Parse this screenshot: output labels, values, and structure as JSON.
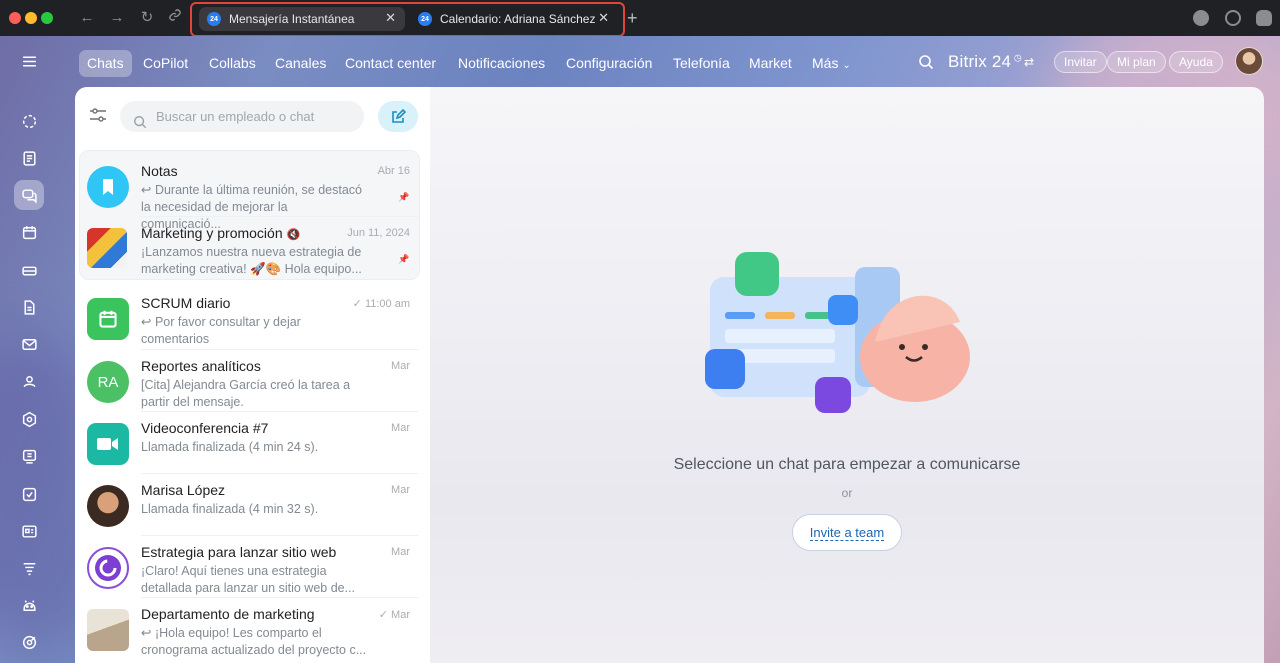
{
  "browser": {
    "tabs": [
      {
        "label": "Mensajería Instantánea",
        "favicon": "24",
        "active": true
      },
      {
        "label": "Calendario: Adriana Sánchez",
        "favicon": "24",
        "active": false
      }
    ]
  },
  "topnav": {
    "items": [
      "Chats",
      "CoPilot",
      "Collabs",
      "Canales",
      "Contact center",
      "Notificaciones",
      "Configuración",
      "Telefonía",
      "Market",
      "Más"
    ],
    "brand": "Bitrix 24",
    "invite": "Invitar",
    "plan": "Mi plan",
    "help": "Ayuda"
  },
  "sidebar_icons": [
    "activity-icon",
    "feed-icon",
    "chat-icon",
    "calendar-icon",
    "drive-icon",
    "document-icon",
    "mail-icon",
    "contacts-icon",
    "crm-icon",
    "boards-icon",
    "tasks-icon",
    "inventory-icon",
    "automation-icon",
    "android-icon",
    "sites-icon"
  ],
  "chatlist": {
    "search_placeholder": "Buscar un empleado o chat",
    "chats": [
      {
        "name": "Notas",
        "date": "Abr 16",
        "msg": "↩ Durante la última reunión, se destacó la necesidad de mejorar la comunicació...",
        "pinned": true
      },
      {
        "name": "Marketing y promoción",
        "date": "Jun 11, 2024",
        "msg": "¡Lanzamos nuestra nueva estrategia de marketing creativa! 🚀🎨 Hola equipo...",
        "pinned": true
      },
      {
        "name": "SCRUM diario",
        "date": "✓ 11:00 am",
        "msg": "↩ Por favor consultar y dejar comentarios"
      },
      {
        "name": "Reportes analíticos",
        "date": "Mar",
        "msg": "[Cita] Alejandra García creó la tarea a partir del mensaje.",
        "initials": "RA"
      },
      {
        "name": "Videoconferencia #7",
        "date": "Mar",
        "msg": "Llamada finalizada (4 min 24 s)."
      },
      {
        "name": "Marisa López",
        "date": "Mar",
        "msg": "Llamada finalizada (4 min 32 s)."
      },
      {
        "name": "Estrategia para lanzar sitio web",
        "date": "Mar",
        "msg": "¡Claro! Aquí tienes una estrategia detallada para lanzar un sitio web de..."
      },
      {
        "name": "Departamento de marketing",
        "date": "✓ Mar",
        "msg": "↩ ¡Hola equipo! Les comparto el cronograma actualizado del proyecto c..."
      }
    ]
  },
  "main": {
    "choose": "Seleccione un chat para empezar a comunicarse",
    "or": "or",
    "invite_team": "Invite a team"
  },
  "colors": {
    "accent": "#2fc6f6",
    "active_tab": "#3a3a3e",
    "highlight": "#e0453a"
  }
}
